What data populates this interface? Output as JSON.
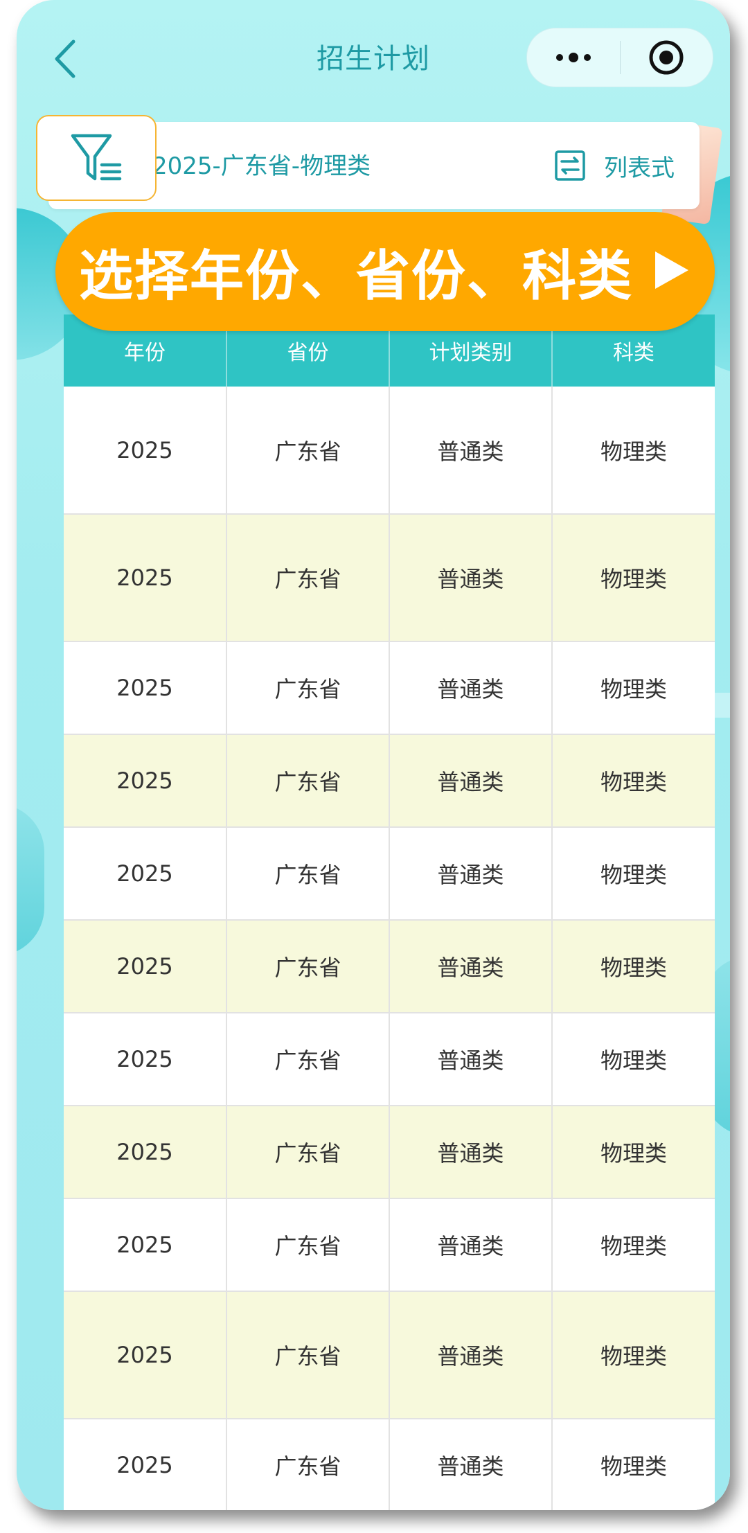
{
  "nav": {
    "title": "招生计划",
    "back_icon": "chevron-left-icon",
    "more_icon": "more-dots-icon",
    "close_icon": "target-circle-icon"
  },
  "filter": {
    "selection_text": "2025-广东省-物理类",
    "view_toggle_label": "列表式",
    "filter_icon": "filter-icon",
    "view_icon": "swap-view-icon"
  },
  "banner": {
    "text": "选择年份、省份、科类",
    "arrow": "▶"
  },
  "colors": {
    "accent": "#1e9aa4",
    "header_bg": "#2fc4c4",
    "banner_bg": "#ffa800",
    "filter_border": "#f5b534",
    "row_alt_bg": "#f7f9dc"
  },
  "table": {
    "headers": [
      "年份",
      "省份",
      "计划类别",
      "科类"
    ],
    "rows": [
      [
        "2025",
        "广东省",
        "普通类",
        "物理类"
      ],
      [
        "2025",
        "广东省",
        "普通类",
        "物理类"
      ],
      [
        "2025",
        "广东省",
        "普通类",
        "物理类"
      ],
      [
        "2025",
        "广东省",
        "普通类",
        "物理类"
      ],
      [
        "2025",
        "广东省",
        "普通类",
        "物理类"
      ],
      [
        "2025",
        "广东省",
        "普通类",
        "物理类"
      ],
      [
        "2025",
        "广东省",
        "普通类",
        "物理类"
      ],
      [
        "2025",
        "广东省",
        "普通类",
        "物理类"
      ],
      [
        "2025",
        "广东省",
        "普通类",
        "物理类"
      ],
      [
        "2025",
        "广东省",
        "普通类",
        "物理类"
      ],
      [
        "2025",
        "广东省",
        "普通类",
        "物理类"
      ]
    ]
  }
}
